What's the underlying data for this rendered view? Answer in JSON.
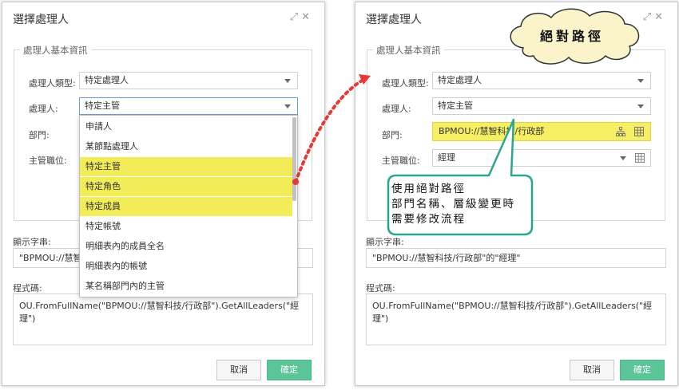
{
  "left_dialog": {
    "title": "選擇處理人",
    "fieldset_legend": "處理人基本資訊",
    "handler_type_label": "處理人類型:",
    "handler_type_value": "特定處理人",
    "handler_label": "處理人:",
    "handler_value": "特定主管",
    "dept_label": "部門:",
    "title_label": "主管職位:",
    "display_label": "顯示字串:",
    "display_value": "\"BPMOU://慧智科技/",
    "code_label": "程式碼:",
    "code_value": "OU.FromFullName(\"BPMOU://慧智科技/行政部\").GetAllLeaders(\"經理\")",
    "cancel_label": "取消",
    "ok_label": "確定",
    "dropdown_items": [
      {
        "label": "申請人",
        "highlighted": false
      },
      {
        "label": "某節點處理人",
        "highlighted": false
      },
      {
        "label": "特定主管",
        "highlighted": true
      },
      {
        "label": "特定角色",
        "highlighted": true
      },
      {
        "label": "特定成員",
        "highlighted": true
      },
      {
        "label": "特定帳號",
        "highlighted": false
      },
      {
        "label": "明細表內的成員全名",
        "highlighted": false
      },
      {
        "label": "明細表內的帳號",
        "highlighted": false
      },
      {
        "label": "某名稱部門內的主管",
        "highlighted": false
      }
    ]
  },
  "right_dialog": {
    "title": "選擇處理人",
    "fieldset_legend": "處理人基本資訊",
    "handler_type_label": "處理人類型:",
    "handler_type_value": "特定處理人",
    "handler_label": "處理人:",
    "handler_value": "特定主管",
    "dept_label": "部門:",
    "dept_value": "BPMOU://慧智科技/行政部",
    "title_label": "主管職位:",
    "title_value": "經理",
    "display_label": "顯示字串:",
    "display_value": "\"BPMOU://慧智科技/行政部\"的\"經理\"",
    "code_label": "程式碼:",
    "code_value": "OU.FromFullName(\"BPMOU://慧智科技/行政部\").GetAllLeaders(\"經理\")",
    "cancel_label": "取消",
    "ok_label": "確定"
  },
  "annotations": {
    "cloud_text": "絕對路徑",
    "callout_lines": [
      "使用絕對路徑",
      "部門名稱、層級變更時",
      "需要修改流程"
    ],
    "highlight_color": "#f6ef64",
    "arrow_color": "#e53935",
    "callout_border_color": "#2aa58f"
  },
  "icons": [
    "expand-icon",
    "close-icon",
    "org-tree-icon",
    "grid-icon"
  ]
}
